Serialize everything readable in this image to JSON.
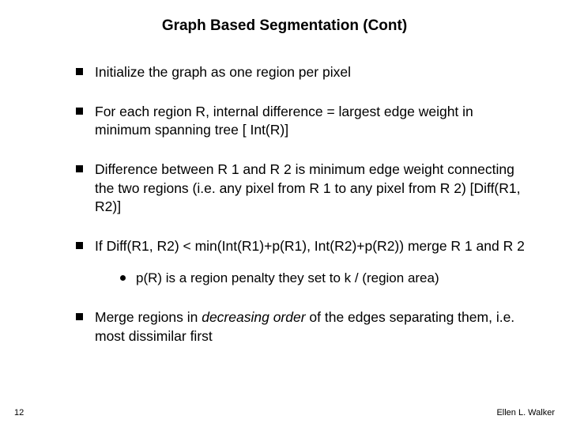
{
  "title": "Graph Based Segmentation (Cont)",
  "bullets": {
    "b0": "Initialize the graph as one region per pixel",
    "b1": "For each region R, internal difference = largest edge weight in minimum spanning tree  [ Int(R)]",
    "b2": "Difference between R 1 and R 2 is minimum edge weight connecting the two regions (i.e. any pixel from R 1 to any pixel from R 2)  [Diff(R1, R2)]",
    "b3": "If Diff(R1, R2) < min(Int(R1)+p(R1), Int(R2)+p(R2)) merge R 1 and R 2",
    "b3_sub0": "p(R) is a region penalty they set to k / (region area)",
    "b4_pre": "Merge regions in ",
    "b4_em": "decreasing order",
    "b4_post": " of the edges separating them, i.e. most dissimilar first"
  },
  "page_number": "12",
  "footer_author": "Ellen L. Walker"
}
